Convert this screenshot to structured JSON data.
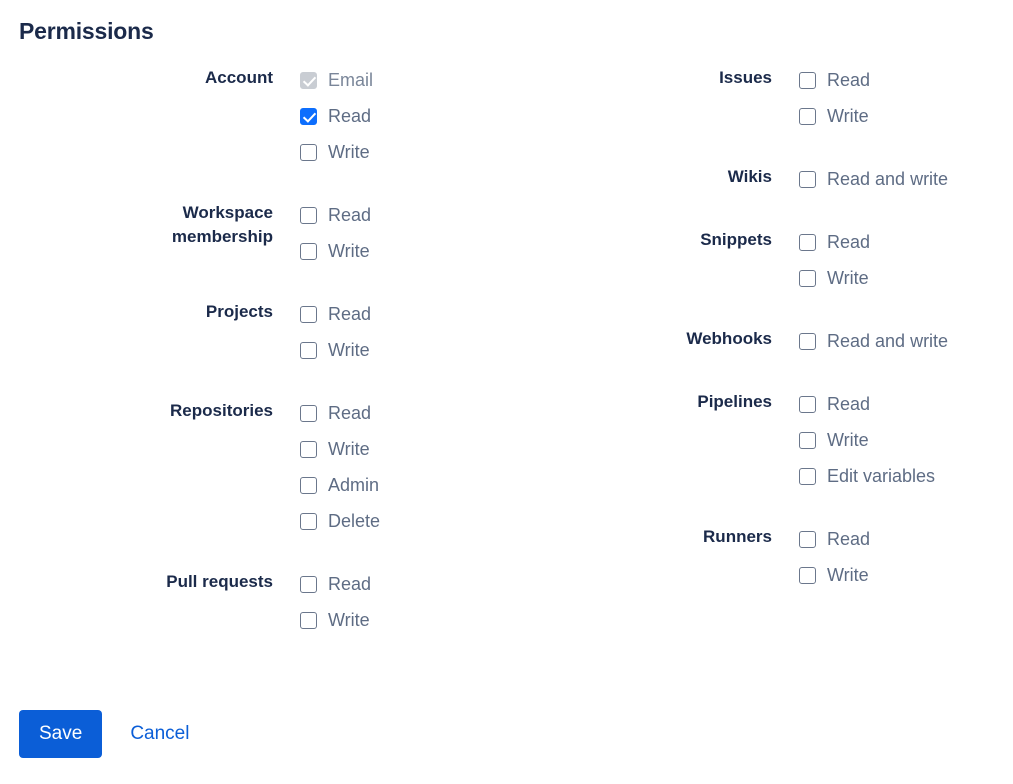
{
  "page": {
    "title": "Permissions"
  },
  "columns": {
    "left": [
      {
        "label": "Account",
        "options": [
          {
            "label": "Email",
            "state": "disabled-checked"
          },
          {
            "label": "Read",
            "state": "checked"
          },
          {
            "label": "Write",
            "state": "unchecked"
          }
        ]
      },
      {
        "label": "Workspace\nmembership",
        "options": [
          {
            "label": "Read",
            "state": "unchecked"
          },
          {
            "label": "Write",
            "state": "unchecked"
          }
        ]
      },
      {
        "label": "Projects",
        "options": [
          {
            "label": "Read",
            "state": "unchecked"
          },
          {
            "label": "Write",
            "state": "unchecked"
          }
        ]
      },
      {
        "label": "Repositories",
        "options": [
          {
            "label": "Read",
            "state": "unchecked"
          },
          {
            "label": "Write",
            "state": "unchecked"
          },
          {
            "label": "Admin",
            "state": "unchecked"
          },
          {
            "label": "Delete",
            "state": "unchecked"
          }
        ]
      },
      {
        "label": "Pull requests",
        "options": [
          {
            "label": "Read",
            "state": "unchecked"
          },
          {
            "label": "Write",
            "state": "unchecked"
          }
        ]
      }
    ],
    "right": [
      {
        "label": "Issues",
        "options": [
          {
            "label": "Read",
            "state": "unchecked"
          },
          {
            "label": "Write",
            "state": "unchecked"
          }
        ]
      },
      {
        "label": "Wikis",
        "options": [
          {
            "label": "Read and write",
            "state": "unchecked"
          }
        ]
      },
      {
        "label": "Snippets",
        "options": [
          {
            "label": "Read",
            "state": "unchecked"
          },
          {
            "label": "Write",
            "state": "unchecked"
          }
        ]
      },
      {
        "label": "Webhooks",
        "options": [
          {
            "label": "Read and write",
            "state": "unchecked"
          }
        ]
      },
      {
        "label": "Pipelines",
        "options": [
          {
            "label": "Read",
            "state": "unchecked"
          },
          {
            "label": "Write",
            "state": "unchecked"
          },
          {
            "label": "Edit variables",
            "state": "unchecked"
          }
        ]
      },
      {
        "label": "Runners",
        "options": [
          {
            "label": "Read",
            "state": "unchecked"
          },
          {
            "label": "Write",
            "state": "unchecked"
          }
        ]
      }
    ]
  },
  "actions": {
    "save_label": "Save",
    "cancel_label": "Cancel"
  },
  "colors": {
    "accent": "#0B5ED7",
    "checkbox_checked": "#0D6EFD",
    "checkbox_disabled": "#C9CDD3",
    "label_text": "#1B2A4A",
    "option_text": "#5E6C84"
  }
}
